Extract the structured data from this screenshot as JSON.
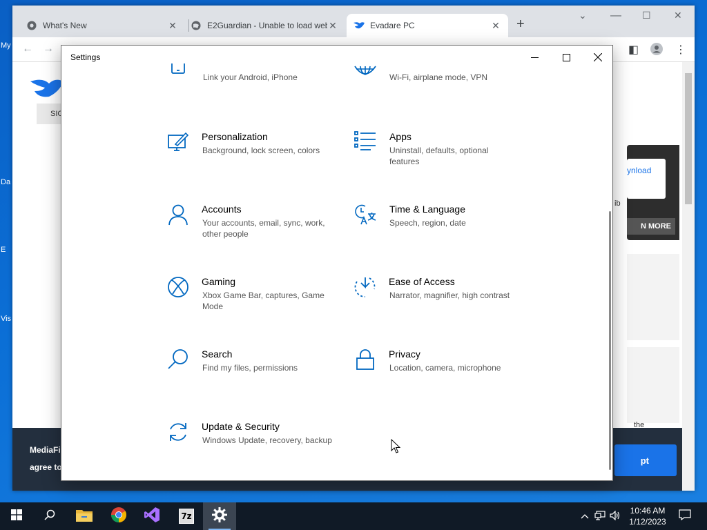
{
  "desktop": {
    "labels": [
      "My",
      "Da",
      "E",
      "Vis"
    ]
  },
  "browser": {
    "tabs": [
      {
        "label": "What's New",
        "icon": "chrome-icon"
      },
      {
        "label": "E2Guardian - Unable to load web",
        "icon": "globe-icon"
      },
      {
        "label": "Evadare PC",
        "icon": "mediafire-icon"
      }
    ],
    "new_tab_label": "+",
    "page": {
      "sign_button": "SIG",
      "download_label": "ynload",
      "dropdown_fragment": "ib",
      "learn_more": "N MORE",
      "the_fragment": "the",
      "banner_line1": "MediaFi",
      "banner_line2": "agree to",
      "accept_label": "pt"
    }
  },
  "settings": {
    "title": "Settings",
    "items": [
      {
        "name": "",
        "desc": "Link your Android, iPhone",
        "icon": "phone-icon"
      },
      {
        "name": "",
        "desc": "Wi-Fi, airplane mode, VPN",
        "icon": "globe-network-icon"
      },
      {
        "name": "Personalization",
        "desc": "Background, lock screen, colors",
        "icon": "personalization-icon"
      },
      {
        "name": "Apps",
        "desc": "Uninstall, defaults, optional features",
        "icon": "apps-list-icon"
      },
      {
        "name": "Accounts",
        "desc": "Your accounts, email, sync, work, other people",
        "icon": "person-icon"
      },
      {
        "name": "Time & Language",
        "desc": "Speech, region, date",
        "icon": "time-language-icon"
      },
      {
        "name": "Gaming",
        "desc": "Xbox Game Bar, captures, Game Mode",
        "icon": "xbox-icon"
      },
      {
        "name": "Ease of Access",
        "desc": "Narrator, magnifier, high contrast",
        "icon": "ease-of-access-icon"
      },
      {
        "name": "Search",
        "desc": "Find my files, permissions",
        "icon": "search-icon"
      },
      {
        "name": "Privacy",
        "desc": "Location, camera, microphone",
        "icon": "lock-icon"
      },
      {
        "name": "Update & Security",
        "desc": "Windows Update, recovery, backup",
        "icon": "update-icon"
      }
    ],
    "accent": "#0067c0"
  },
  "taskbar": {
    "apps": [
      "start-icon",
      "search-icon",
      "file-explorer-icon",
      "chrome-icon",
      "visual-studio-icon",
      "7zip-icon",
      "settings-gear-icon"
    ],
    "zip_label": "7z",
    "time": "10:46 AM",
    "date": "1/12/2023"
  }
}
